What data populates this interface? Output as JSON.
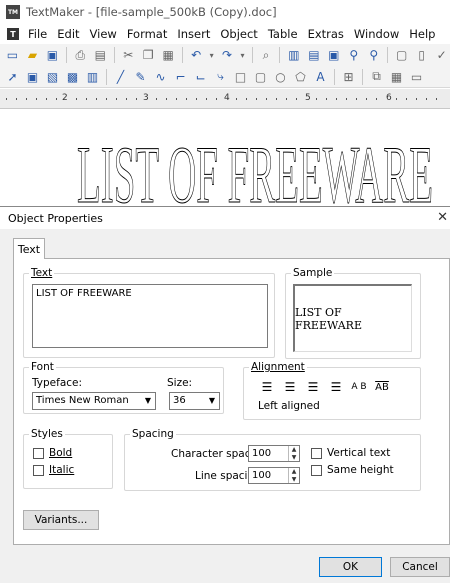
{
  "window": {
    "title": "TextMaker - [file-sample_500kB (Copy).doc]",
    "app_icon": "TM"
  },
  "menu": [
    "File",
    "Edit",
    "View",
    "Format",
    "Insert",
    "Object",
    "Table",
    "Extras",
    "Window",
    "Help"
  ],
  "ruler": [
    "2",
    "3",
    "4",
    "5",
    "6"
  ],
  "document": {
    "heading": "LIST OF FREEWARE"
  },
  "dialog": {
    "title": "Object Properties",
    "tab": "Text",
    "text_group": {
      "label": "Text",
      "value": "LIST OF FREEWARE"
    },
    "sample_group": {
      "label": "Sample",
      "preview": "LIST OF FREEWARE"
    },
    "font_group": {
      "label": "Font",
      "typeface_label": "Typeface:",
      "typeface": "Times New Roman",
      "size_label": "Size:",
      "size": "36"
    },
    "alignment_group": {
      "label": "Alignment",
      "status": "Left aligned"
    },
    "styles_group": {
      "label": "Styles",
      "bold": "Bold",
      "italic": "Italic"
    },
    "spacing_group": {
      "label": "Spacing",
      "char_label": "Character spacing:",
      "char_value": "100",
      "line_label": "Line spacing:",
      "line_value": "100",
      "vertical": "Vertical text",
      "same_height": "Same height"
    },
    "variants_button": "Variants...",
    "ok_button": "OK",
    "cancel_button": "Cancel"
  }
}
